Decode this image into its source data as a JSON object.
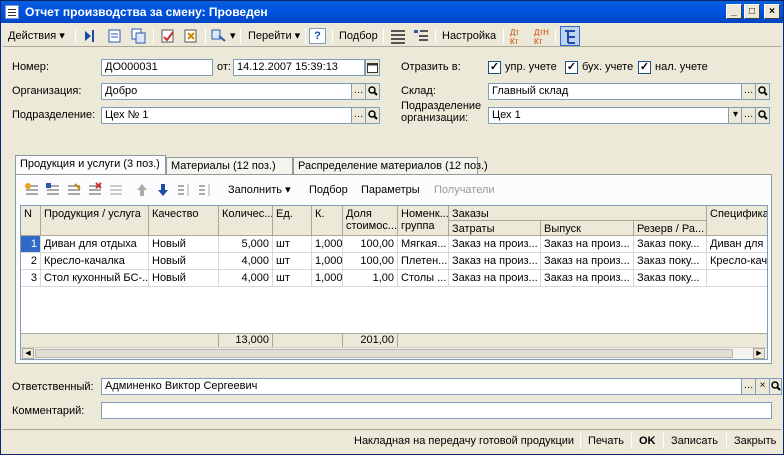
{
  "window": {
    "title": "Отчет производства за смену: Проведен"
  },
  "toolbar": {
    "actions": "Действия",
    "goto": "Перейти",
    "help": "?",
    "select": "Подбор",
    "settings": "Настройка",
    "dt_kt": "Дт Кт",
    "dt_n_kt": "ДтН Кт"
  },
  "header": {
    "number_label": "Номер:",
    "number_value": "ДО000031",
    "date_label": "от:",
    "date_value": "14.12.2007 15:39:13",
    "reflect_label": "Отразить в:",
    "upr_label": "упр. учете",
    "buh_label": "бух. учете",
    "nal_label": "нал. учете",
    "org_label": "Организация:",
    "org_value": "Добро",
    "warehouse_label": "Склад:",
    "warehouse_value": "Главный склад",
    "dept_label": "Подразделение:",
    "dept_value": "Цех № 1",
    "org_dept_label1": "Подразделение",
    "org_dept_label2": "организации:",
    "org_dept_value": "Цех 1"
  },
  "tabs": [
    {
      "label": "Продукция и услуги (3 поз.)"
    },
    {
      "label": "Материалы (12 поз.)"
    },
    {
      "label": "Распределение материалов (12 поз.)"
    }
  ],
  "panel_toolbar": {
    "fill": "Заполнить",
    "select": "Подбор",
    "params": "Параметры",
    "recipients": "Получатели"
  },
  "grid": {
    "columns": {
      "n": "N",
      "product": "Продукция / услуга",
      "quality": "Качество",
      "qty": "Количес...",
      "unit": "Ед.",
      "k": "К.",
      "share1": "Доля",
      "share2": "стоимос...",
      "nom1": "Номенк...",
      "nom2": "группа",
      "orders": "Заказы",
      "costs": "Затраты",
      "output": "Выпуск",
      "reserve": "Резерв / Ра...",
      "spec": "Специфика..."
    },
    "rows": [
      {
        "n": "1",
        "product": "Диван для отдыха",
        "quality": "Новый",
        "qty": "5,000",
        "unit": "шт",
        "k": "1,000",
        "share": "100,00",
        "nom": "Мягкая...",
        "costs": "Заказ на произ...",
        "output": "Заказ на произ...",
        "reserve": "Заказ поку...",
        "spec": "Диван для"
      },
      {
        "n": "2",
        "product": "Кресло-качалка",
        "quality": "Новый",
        "qty": "4,000",
        "unit": "шт",
        "k": "1,000",
        "share": "100,00",
        "nom": "Плетен...",
        "costs": "Заказ на произ...",
        "output": "Заказ на произ...",
        "reserve": "Заказ поку...",
        "spec": "Кресло-кач"
      },
      {
        "n": "3",
        "product": "Стол кухонный БС-...",
        "quality": "Новый",
        "qty": "4,000",
        "unit": "шт",
        "k": "1,000",
        "share": "1,00",
        "nom": "Столы ...",
        "costs": "Заказ на произ...",
        "output": "Заказ на произ...",
        "reserve": "Заказ поку...",
        "spec": ""
      }
    ],
    "totals": {
      "qty": "13,000",
      "share": "201,00"
    }
  },
  "footer": {
    "responsible_label": "Ответственный:",
    "responsible_value": "Админенко Виктор Сергеевич",
    "comment_label": "Комментарий:",
    "comment_value": ""
  },
  "statusbar": {
    "invoice": "Накладная на передачу готовой продукции",
    "print": "Печать",
    "ok": "OK",
    "save": "Записать",
    "close": "Закрыть"
  }
}
